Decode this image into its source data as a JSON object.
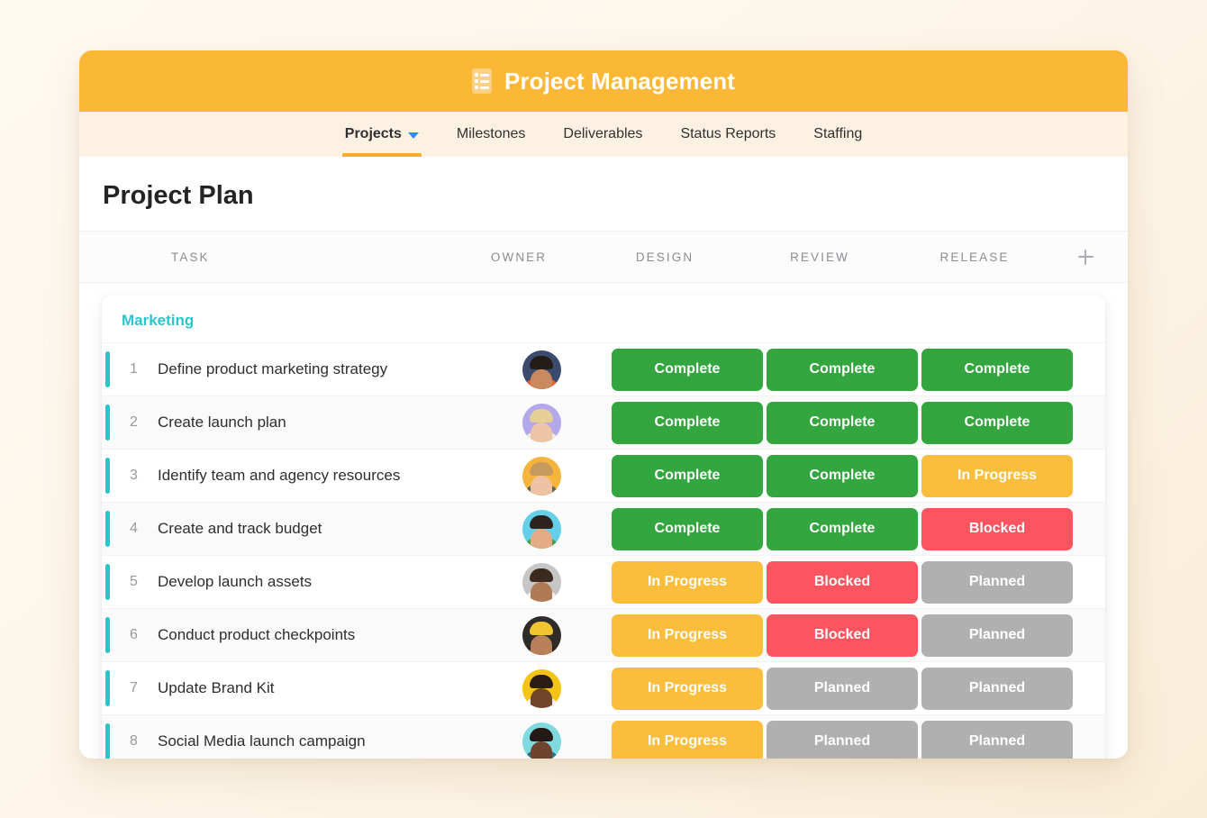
{
  "window": {
    "title": "Project Management",
    "title_icon": "checklist-icon"
  },
  "nav": {
    "items": [
      {
        "label": "Projects",
        "active": true,
        "has_caret": true
      },
      {
        "label": "Milestones",
        "active": false,
        "has_caret": false
      },
      {
        "label": "Deliverables",
        "active": false,
        "has_caret": false
      },
      {
        "label": "Status Reports",
        "active": false,
        "has_caret": false
      },
      {
        "label": "Staffing",
        "active": false,
        "has_caret": false
      }
    ]
  },
  "page": {
    "title": "Project Plan"
  },
  "table": {
    "columns": {
      "task": "TASK",
      "owner": "OWNER",
      "design": "DESIGN",
      "review": "REVIEW",
      "release": "RELEASE",
      "add_icon": "plus-icon"
    },
    "group": {
      "label": "Marketing",
      "color": "#2bc6cd"
    },
    "rows": [
      {
        "num": "1",
        "task": "Define product marketing strategy",
        "owner_avatar": {
          "bg": "#3c4a6e",
          "hair": "#241c16",
          "shirt": "#f4622c",
          "skin": "#c98a60"
        },
        "design": "Complete",
        "review": "Complete",
        "release": "Complete"
      },
      {
        "num": "2",
        "task": "Create launch plan",
        "owner_avatar": {
          "bg": "#b3a8ea",
          "hair": "#e6cf97",
          "shirt": "#f2e9df",
          "skin": "#eec4a6"
        },
        "design": "Complete",
        "review": "Complete",
        "release": "Complete"
      },
      {
        "num": "3",
        "task": "Identify team and agency resources",
        "owner_avatar": {
          "bg": "#f5b43c",
          "hair": "#c79b5e",
          "shirt": "#5d6553",
          "skin": "#eec2a2"
        },
        "design": "Complete",
        "review": "Complete",
        "release": "In Progress"
      },
      {
        "num": "4",
        "task": "Create and track budget",
        "owner_avatar": {
          "bg": "#63cfe8",
          "hair": "#2e2320",
          "shirt": "#4d9c45",
          "skin": "#e5ab84"
        },
        "design": "Complete",
        "review": "Complete",
        "release": "Blocked"
      },
      {
        "num": "5",
        "task": "Develop launch assets",
        "owner_avatar": {
          "bg": "#c6c6c6",
          "hair": "#3d2a1e",
          "shirt": "#f1f1f1",
          "skin": "#b07a54"
        },
        "design": "In Progress",
        "review": "Blocked",
        "release": "Planned"
      },
      {
        "num": "6",
        "task": "Conduct product checkpoints",
        "owner_avatar": {
          "bg": "#2f2b29",
          "hair": "#f0c331",
          "shirt": "#2a2320",
          "skin": "#b9815a"
        },
        "design": "In Progress",
        "review": "Blocked",
        "release": "Planned"
      },
      {
        "num": "7",
        "task": "Update Brand Kit",
        "owner_avatar": {
          "bg": "#f3c417",
          "hair": "#2a1d17",
          "shirt": "#efefef",
          "skin": "#70452c"
        },
        "design": "In Progress",
        "review": "Planned",
        "release": "Planned"
      },
      {
        "num": "8",
        "task": "Social Media launch campaign",
        "owner_avatar": {
          "bg": "#7fd9de",
          "hair": "#231a16",
          "shirt": "#2f6f86",
          "skin": "#6d452f"
        },
        "design": "In Progress",
        "review": "Planned",
        "release": "Planned"
      }
    ]
  },
  "status_colors": {
    "Complete": "#33a63f",
    "In Progress": "#fbbe3c",
    "Blocked": "#fc555f",
    "Planned": "#b0b0b0"
  },
  "theme": {
    "header_bg": "#fbb836",
    "nav_bg": "#fdf1e2",
    "page_bg": "#fdf6ea",
    "accent_bar": "#2bc4c9",
    "active_tab_underline": "#f5ab2b",
    "caret": "#2f8cf5"
  }
}
